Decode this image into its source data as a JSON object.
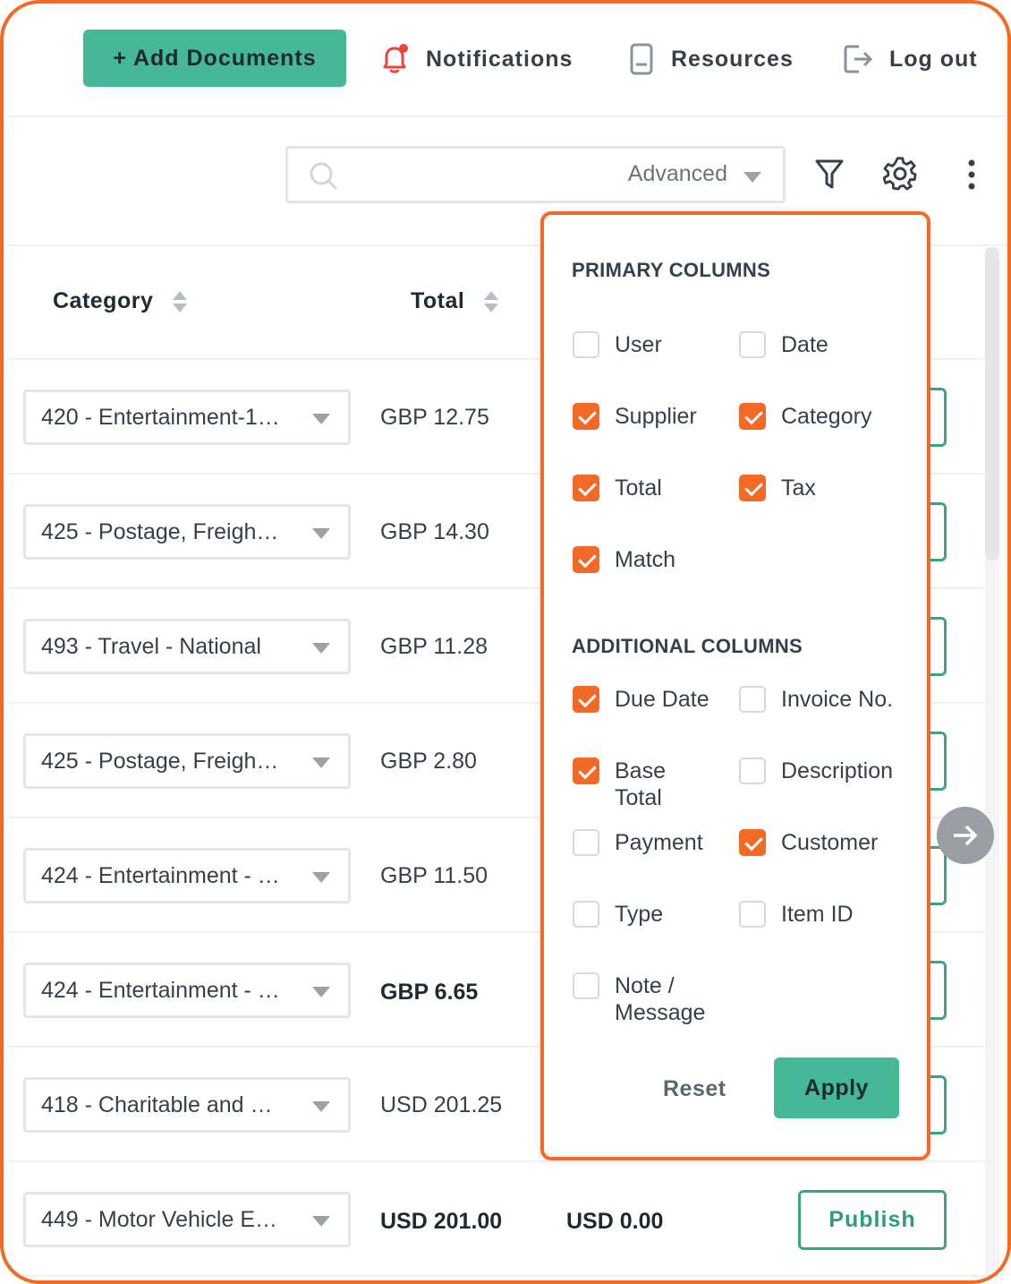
{
  "header": {
    "add_documents": "+ Add Documents",
    "notifications": "Notifications",
    "resources": "Resources",
    "log_out": "Log out"
  },
  "search": {
    "placeholder": "",
    "mode": "Advanced"
  },
  "table": {
    "columns": [
      "Category",
      "Total"
    ],
    "rows": [
      {
        "category": "420 - Entertainment-1…",
        "total": "GBP 12.75"
      },
      {
        "category": "425 - Postage, Freigh…",
        "total": "GBP 14.30"
      },
      {
        "category": "493 - Travel - National",
        "total": "GBP 11.28"
      },
      {
        "category": "425 - Postage, Freigh…",
        "total": "GBP 2.80"
      },
      {
        "category": "424 - Entertainment - …",
        "total": "GBP 11.50"
      },
      {
        "category": "424 - Entertainment - …",
        "total": "GBP 6.65"
      },
      {
        "category": "418 - Charitable and …",
        "total": "USD 201.25"
      },
      {
        "category": "449 - Motor Vehicle E…",
        "total": "USD 201.00",
        "tax": "USD 0.00",
        "action": "Publish"
      }
    ]
  },
  "panel": {
    "primary_title": "PRIMARY COLUMNS",
    "primary": [
      {
        "label": "User",
        "checked": false
      },
      {
        "label": "Date",
        "checked": false
      },
      {
        "label": "Supplier",
        "checked": true
      },
      {
        "label": "Category",
        "checked": true
      },
      {
        "label": "Total",
        "checked": true
      },
      {
        "label": "Tax",
        "checked": true
      },
      {
        "label": "Match",
        "checked": true
      }
    ],
    "additional_title": "ADDITIONAL COLUMNS",
    "additional": [
      {
        "label": "Due Date",
        "checked": true
      },
      {
        "label": "Invoice No.",
        "checked": false
      },
      {
        "label": "Base Total",
        "checked": true
      },
      {
        "label": "Description",
        "checked": false
      },
      {
        "label": "Payment",
        "checked": false
      },
      {
        "label": "Customer",
        "checked": true
      },
      {
        "label": "Type",
        "checked": false
      },
      {
        "label": "Item ID",
        "checked": false
      },
      {
        "label": "Note / Message",
        "checked": false
      }
    ],
    "reset": "Reset",
    "apply": "Apply"
  },
  "colors": {
    "accent": "#f26a25",
    "primary": "#44b897",
    "text": "#37404a"
  },
  "icons": [
    "search-icon",
    "filter-icon",
    "settings-gear-icon",
    "more-vertical-icon",
    "bell-icon",
    "document-icon",
    "logout-icon",
    "arrow-right-icon"
  ]
}
